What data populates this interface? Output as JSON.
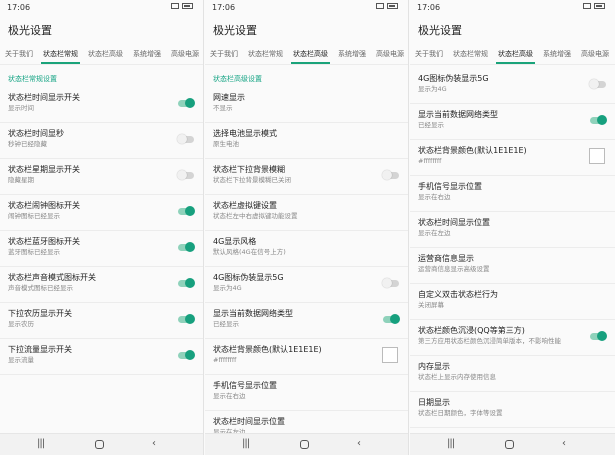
{
  "status_time": "17:06",
  "app_title": "极光设置",
  "tabs": [
    "关于我们",
    "状态栏常规",
    "状态栏高级",
    "系统增强",
    "高级电源"
  ],
  "panel1": {
    "section": "状态栏常规设置",
    "items": [
      {
        "title": "状态栏时间显示开关",
        "sub": "显示时间",
        "on": true
      },
      {
        "title": "状态栏时间显秒",
        "sub": "秒钟已经隐藏",
        "on": false
      },
      {
        "title": "状态栏星期显示开关",
        "sub": "隐藏星期",
        "on": false
      },
      {
        "title": "状态栏闹钟图标开关",
        "sub": "闹钟图标已经显示",
        "on": true
      },
      {
        "title": "状态栏蓝牙图标开关",
        "sub": "蓝牙图标已经显示",
        "on": true
      },
      {
        "title": "状态栏声音模式图标开关",
        "sub": "声音模式图标已经显示",
        "on": true
      },
      {
        "title": "下拉农历显示开关",
        "sub": "显示农历",
        "on": true
      },
      {
        "title": "下拉流量显示开关",
        "sub": "显示流量",
        "on": true
      }
    ]
  },
  "panel2": {
    "section": "状态栏高级设置",
    "items": [
      {
        "title": "网速显示",
        "sub": "不显示",
        "kind": "none"
      },
      {
        "title": "选择电池显示模式",
        "sub": "原生电池",
        "kind": "none"
      },
      {
        "title": "状态栏下拉背景模糊",
        "sub": "状态栏下拉背景模糊已关闭",
        "kind": "toggle",
        "on": false
      },
      {
        "title": "状态栏虚拟键设置",
        "sub": "状态栏左中右虚拟键功能设置",
        "kind": "none"
      },
      {
        "title": "4G显示风格",
        "sub": "默认风格(4G在信号上方)",
        "kind": "none"
      },
      {
        "title": "4G图标伪装显示5G",
        "sub": "显示为4G",
        "kind": "toggle",
        "on": false
      },
      {
        "title": "显示当前数据网络类型",
        "sub": "已经显示",
        "kind": "toggle",
        "on": true
      },
      {
        "title": "状态栏背景颜色(默认1E1E1E)",
        "sub": "#ffffffff",
        "kind": "color"
      },
      {
        "title": "手机信号显示位置",
        "sub": "显示在右边",
        "kind": "none"
      },
      {
        "title": "状态栏时间显示位置",
        "sub": "显示在左边",
        "kind": "none"
      }
    ]
  },
  "panel3": {
    "items": [
      {
        "title": "4G图标伪装显示5G",
        "sub": "显示为4G",
        "kind": "toggle",
        "on": false
      },
      {
        "title": "显示当前数据网络类型",
        "sub": "已经显示",
        "kind": "toggle",
        "on": true
      },
      {
        "title": "状态栏背景颜色(默认1E1E1E)",
        "sub": "#ffffffff",
        "kind": "color"
      },
      {
        "title": "手机信号显示位置",
        "sub": "显示在右边",
        "kind": "none"
      },
      {
        "title": "状态栏时间显示位置",
        "sub": "显示在左边",
        "kind": "none"
      },
      {
        "title": "运营商信息显示",
        "sub": "运营商信息显示高级设置",
        "kind": "none"
      },
      {
        "title": "自定义双击状态栏行为",
        "sub": "关闭屏幕",
        "kind": "none"
      },
      {
        "title": "状态栏颜色沉浸(QQ等第三方)",
        "sub": "第三方应用状态栏颜色沉浸简单版本，不影响性能",
        "kind": "toggle",
        "on": true
      },
      {
        "title": "内存显示",
        "sub": "状态栏上显示内存使用信息",
        "kind": "none"
      },
      {
        "title": "日期显示",
        "sub": "状态栏日期颜色，字体等设置",
        "kind": "none"
      }
    ]
  },
  "colors": {
    "accent": "#1aa37a",
    "toggle_on_track": "#8fd2bb",
    "toggle_off_track": "#d4d4d4"
  }
}
